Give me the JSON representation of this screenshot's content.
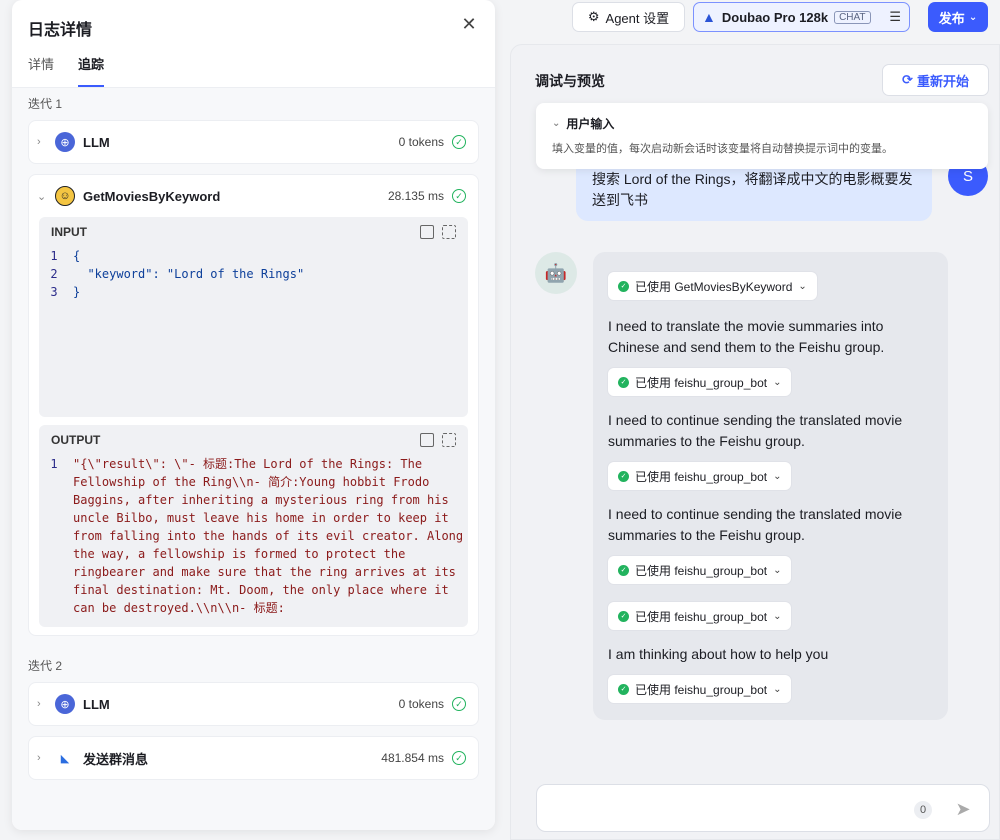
{
  "left_panel": {
    "title": "日志详情",
    "close_icon": "close-icon",
    "tabs": [
      "详情",
      "追踪"
    ],
    "active_tab": "追踪",
    "iterations": [
      {
        "label": "迭代 1",
        "nodes": [
          {
            "name": "LLM",
            "meta": "0 tokens",
            "icon": "llm-icon"
          },
          {
            "name": "GetMoviesByKeyword",
            "meta": "28.135 ms",
            "icon": "movie-plugin-icon",
            "input_label": "INPUT",
            "input_lines": [
              "{",
              "  \"keyword\": \"Lord of the Rings\"",
              "}"
            ],
            "output_label": "OUTPUT",
            "output_text": "\"{\\\"result\\\": \\\"- 标题:The Lord of the Rings: The Fellowship of the Ring\\\\n- 简介:Young hobbit Frodo Baggins, after inheriting a mysterious ring from his uncle Bilbo, must leave his home in order to keep it from falling into the hands of its evil creator. Along the way, a fellowship is formed to protect the ringbearer and make sure that the ring arrives at its final destination: Mt. Doom, the only place where it can be destroyed.\\\\n\\\\n- 标题:"
          }
        ]
      },
      {
        "label": "迭代 2",
        "nodes": [
          {
            "name": "LLM",
            "meta": "0 tokens",
            "icon": "llm-icon"
          },
          {
            "name": "发送群消息",
            "meta": "481.854 ms",
            "icon": "feishu-icon"
          }
        ]
      }
    ]
  },
  "header": {
    "agent_settings": "Agent 设置",
    "model_name": "Doubao Pro 128k",
    "model_badge": "CHAT",
    "publish": "发布"
  },
  "preview": {
    "title": "调试与预览",
    "restart": "重新开始",
    "user_input_label": "用户输入",
    "user_input_desc": "填入变量的值，每次启动新会话时该变量将自动替换提示词中的变量。",
    "user_message": "搜索 Lord of the Rings，将翻译成中文的电影概要发送到飞书",
    "user_avatar": "S",
    "bot_items": [
      {
        "type": "tool",
        "label": "已使用 GetMoviesByKeyword"
      },
      {
        "type": "text",
        "text": "I need to translate the movie summaries into Chinese and send them to the Feishu group."
      },
      {
        "type": "tool",
        "label": "已使用 feishu_group_bot"
      },
      {
        "type": "text",
        "text": "I need to continue sending the translated movie summaries to the Feishu group."
      },
      {
        "type": "tool",
        "label": "已使用 feishu_group_bot"
      },
      {
        "type": "text",
        "text": "I need to continue sending the translated movie summaries to the Feishu group."
      },
      {
        "type": "tool",
        "label": "已使用 feishu_group_bot"
      },
      {
        "type": "tool",
        "label": "已使用 feishu_group_bot"
      },
      {
        "type": "text",
        "text": "I am thinking about how to help you"
      },
      {
        "type": "tool",
        "label": "已使用 feishu_group_bot"
      }
    ],
    "composer_count": "0"
  },
  "colors": {
    "accent": "#3b5bfd",
    "success": "#22b35e"
  }
}
